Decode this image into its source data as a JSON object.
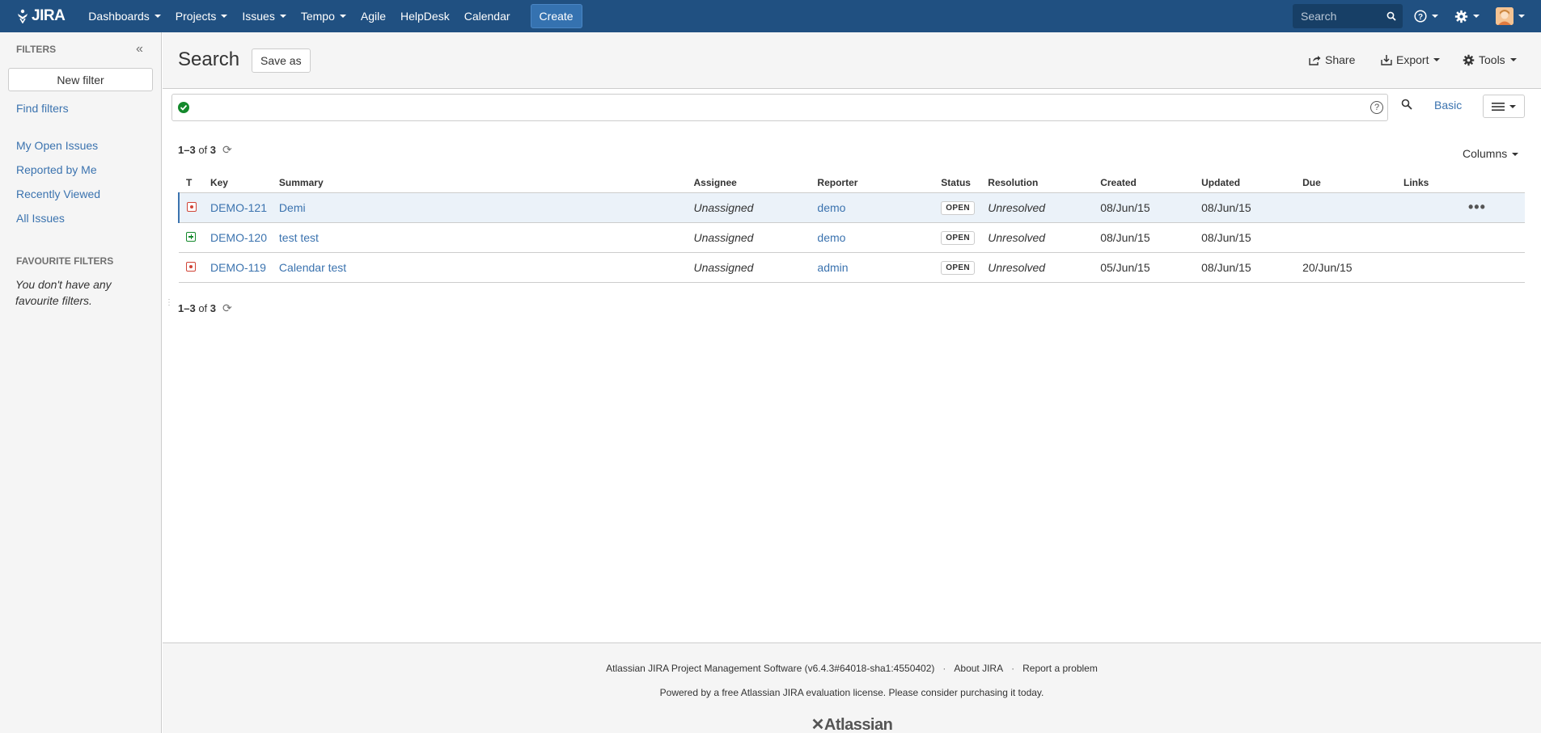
{
  "brand": {
    "logo_text": "JIRA"
  },
  "nav": {
    "items": [
      {
        "label": "Dashboards",
        "dropdown": true
      },
      {
        "label": "Projects",
        "dropdown": true
      },
      {
        "label": "Issues",
        "dropdown": true
      },
      {
        "label": "Tempo",
        "dropdown": true
      },
      {
        "label": "Agile",
        "dropdown": false
      },
      {
        "label": "HelpDesk",
        "dropdown": false
      },
      {
        "label": "Calendar",
        "dropdown": false
      }
    ],
    "create_label": "Create",
    "search_placeholder": "Search"
  },
  "sidebar": {
    "header": "FILTERS",
    "new_filter_label": "New filter",
    "find_filters": "Find filters",
    "system_filters": [
      "My Open Issues",
      "Reported by Me",
      "Recently Viewed",
      "All Issues"
    ],
    "favourites_header": "FAVOURITE FILTERS",
    "favourites_empty": "You don't have any favourite filters."
  },
  "main": {
    "title": "Search",
    "save_as": "Save as",
    "tools": {
      "share": "Share",
      "export": "Export",
      "tools": "Tools"
    },
    "basic_link": "Basic",
    "count": {
      "range": "1–3",
      "of": "of",
      "total": "3"
    },
    "columns_label": "Columns"
  },
  "table": {
    "headers": {
      "type": "T",
      "key": "Key",
      "summary": "Summary",
      "assignee": "Assignee",
      "reporter": "Reporter",
      "status": "Status",
      "resolution": "Resolution",
      "created": "Created",
      "updated": "Updated",
      "due": "Due",
      "links": "Links"
    },
    "rows": [
      {
        "type": "bug",
        "key": "DEMO-121",
        "summary": "Demi",
        "assignee": "Unassigned",
        "reporter": "demo",
        "status": "OPEN",
        "resolution": "Unresolved",
        "created": "08/Jun/15",
        "updated": "08/Jun/15",
        "due": ""
      },
      {
        "type": "new-feature",
        "key": "DEMO-120",
        "summary": "test test",
        "assignee": "Unassigned",
        "reporter": "demo",
        "status": "OPEN",
        "resolution": "Unresolved",
        "created": "08/Jun/15",
        "updated": "08/Jun/15",
        "due": ""
      },
      {
        "type": "bug",
        "key": "DEMO-119",
        "summary": "Calendar test",
        "assignee": "Unassigned",
        "reporter": "admin",
        "status": "OPEN",
        "resolution": "Unresolved",
        "created": "05/Jun/15",
        "updated": "08/Jun/15",
        "due": "20/Jun/15"
      }
    ]
  },
  "footer": {
    "software": "Atlassian JIRA Project Management Software (v6.4.3#64018-sha1:4550402)",
    "about": "About JIRA",
    "report": "Report a problem",
    "license": "Powered by a free Atlassian JIRA evaluation license. Please consider purchasing it today.",
    "logo_text": "Atlassian"
  },
  "colors": {
    "header_bg": "#205081",
    "link": "#3b73af",
    "create_btn": "#3572b0",
    "bug": "#d04437",
    "feature": "#14892c"
  }
}
